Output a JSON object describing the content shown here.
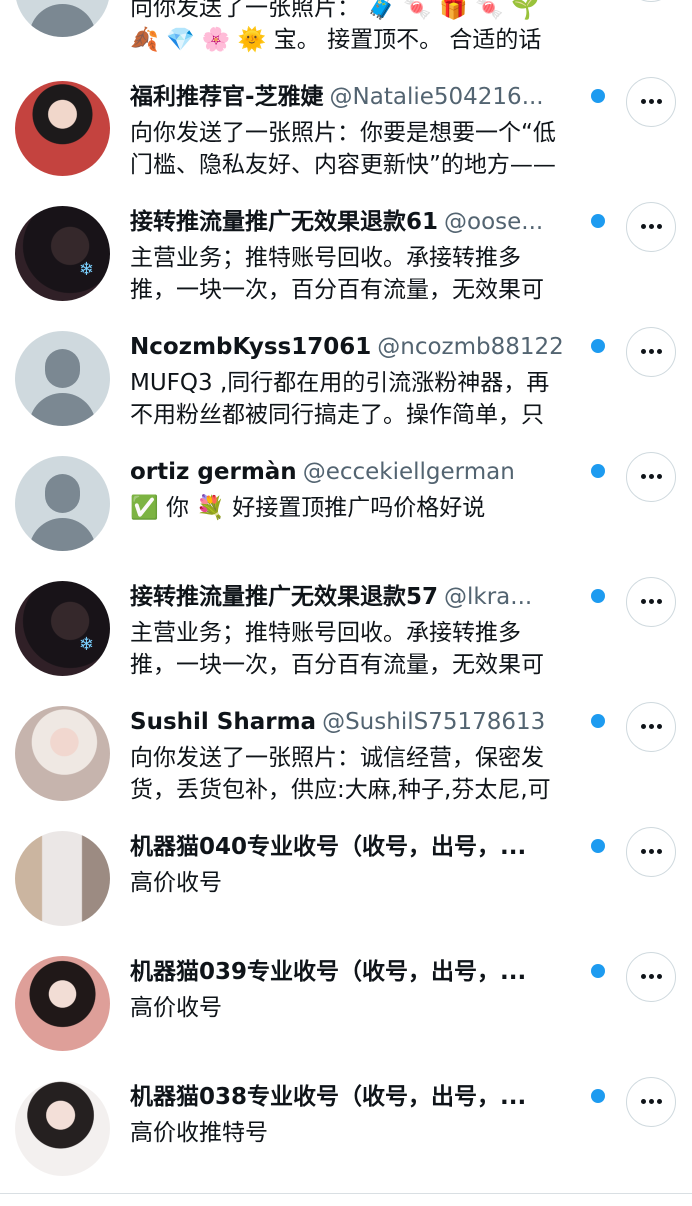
{
  "rows": [
    {
      "name": "",
      "handle": "",
      "preview": [
        "向你发送了一张照片： 🧳 🍬 🎁 🍬 🌱",
        "🍂 💎 🌸 🌞 宝。 接置顶不。 合适的话"
      ]
    },
    {
      "name": "福利推荐官-芝雅婕",
      "handle": "@Natalie504216...",
      "preview": [
        "向你发送了一张照片：你要是想要一个“低",
        "门槛、隐私友好、内容更新快”的地方——"
      ]
    },
    {
      "name": "接转推流量推广无效果退款61",
      "handle": "@oose...",
      "preview": [
        "主营业务；推特账号回收。承接转推多",
        "推，一块一次，百分百有流量，无效果可"
      ]
    },
    {
      "name": "NcozmbKyss17061",
      "handle": "@ncozmb88122",
      "preview": [
        "MUFQ3 ,同行都在用的引流涨粉神器，再",
        "不用粉丝都被同行搞走了。操作简单，只"
      ]
    },
    {
      "name": "ortiz germàn",
      "handle": "@eccekiellgerman",
      "preview": [
        "✅ 你 💐 好接置顶推广吗价格好说"
      ]
    },
    {
      "name": "接转推流量推广无效果退款57",
      "handle": "@lkra...",
      "preview": [
        "主营业务；推特账号回收。承接转推多",
        "推，一块一次，百分百有流量，无效果可"
      ]
    },
    {
      "name": "Sushil Sharma",
      "handle": "@SushilS75178613",
      "preview": [
        "向你发送了一张照片：诚信经营，保密发",
        "货，丢货包补，供应:大麻,种子,芬太尼,可"
      ]
    },
    {
      "name": "机器猫040专业收号（收号，出号，...",
      "handle": "",
      "preview": [
        "高价收号"
      ]
    },
    {
      "name": "机器猫039专业收号（收号，出号，...",
      "handle": "",
      "preview": [
        "高价收号"
      ]
    },
    {
      "name": "机器猫038专业收号（收号，出号，...",
      "handle": "",
      "preview": [
        "高价收推特号"
      ]
    }
  ],
  "more_icon": "more-icon",
  "unread_color": "#1d9bf0"
}
